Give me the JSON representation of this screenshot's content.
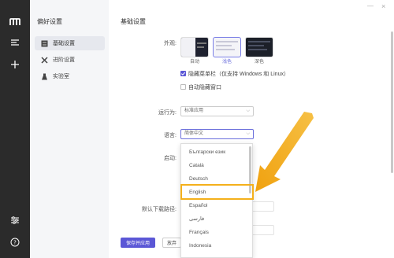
{
  "sidebar": {
    "title": "偏好设置",
    "items": [
      {
        "label": "基础设置",
        "icon": "settings-sliders-icon"
      },
      {
        "label": "进阶设置",
        "icon": "tools-icon"
      },
      {
        "label": "实验室",
        "icon": "flask-icon"
      }
    ]
  },
  "main": {
    "title": "基础设置",
    "appearance_label": "外观:",
    "themes": [
      {
        "label": "自动"
      },
      {
        "label": "浅色"
      },
      {
        "label": "深色"
      }
    ],
    "hide_menubar_label": "隐藏菜单栏（仅支持 Windows 和 Linux）",
    "auto_hide_window_label": "自动隐藏窗口",
    "run_as_label": "运行为:",
    "run_as_value": "标准应用",
    "language_label": "语言:",
    "language_value": "简体中文",
    "startup_label": "启动:",
    "download_path_label": "默认下载路径:",
    "save_button": "保存并应用",
    "discard_button": "放弃"
  },
  "language_dropdown": {
    "options": [
      "Български език",
      "Català",
      "Deutsch",
      "English",
      "Español",
      "فارسی",
      "Français",
      "Indonesia"
    ],
    "highlighted": "English"
  },
  "colors": {
    "accent": "#5b57d6",
    "highlight": "#f4b01b",
    "rail": "#2b2b2b"
  }
}
